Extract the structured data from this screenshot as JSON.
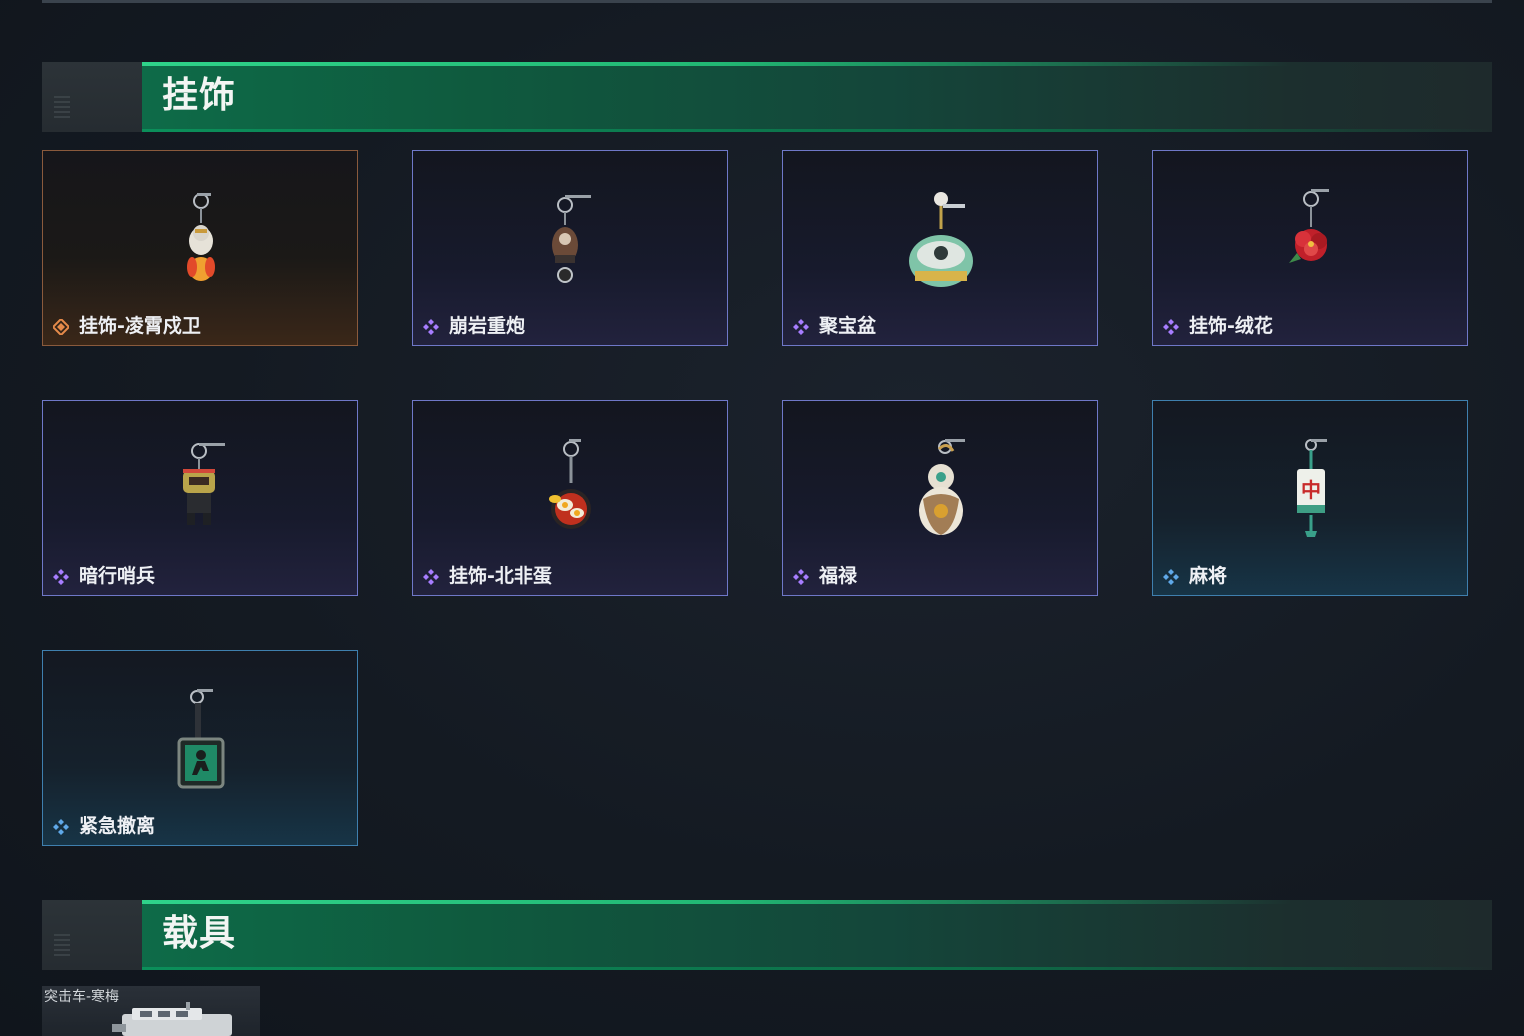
{
  "sections": {
    "charms": {
      "title": "挂饰"
    },
    "vehicles": {
      "title": "载具"
    }
  },
  "colors": {
    "header_green": "#0e6b48",
    "header_green_light": "#2fd38a",
    "rarity_purple": "#a77dff",
    "rarity_orange": "#e58a4a",
    "rarity_blue": "#5fa8e8"
  },
  "items": [
    {
      "name": "挂饰-凌霄戍卫",
      "rarity": "orange",
      "icon": "robot-doll-charm-icon"
    },
    {
      "name": "崩岩重炮",
      "rarity": "purple",
      "icon": "cannon-doll-charm-icon"
    },
    {
      "name": "聚宝盆",
      "rarity": "purple",
      "icon": "treasure-bowl-charm-icon"
    },
    {
      "name": "挂饰-绒花",
      "rarity": "purple",
      "icon": "red-flower-charm-icon"
    },
    {
      "name": "暗行哨兵",
      "rarity": "purple",
      "icon": "sentry-doll-charm-icon"
    },
    {
      "name": "挂饰-北非蛋",
      "rarity": "purple",
      "icon": "shakshuka-pan-charm-icon"
    },
    {
      "name": "福禄",
      "rarity": "purple",
      "icon": "gourd-charm-icon"
    },
    {
      "name": "麻将",
      "rarity": "blue",
      "icon": "mahjong-tile-charm-icon"
    },
    {
      "name": "紧急撤离",
      "rarity": "blue",
      "icon": "exit-sign-charm-icon"
    }
  ],
  "vehicle_preview": {
    "name": "突击车-寒梅",
    "icon": "assault-vehicle-icon"
  }
}
